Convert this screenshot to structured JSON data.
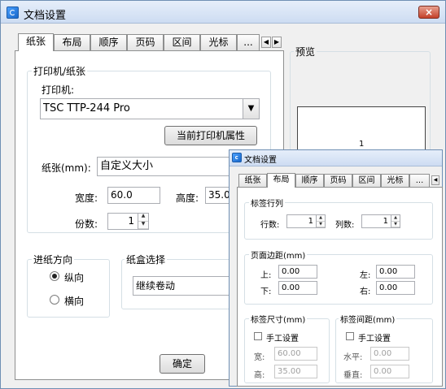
{
  "main_dialog": {
    "title": "文档设置",
    "close_label": "×",
    "tabs": [
      "纸张",
      "布局",
      "顺序",
      "页码",
      "区间",
      "光标",
      "..."
    ],
    "printer_group_title": "打印机/纸张",
    "printer_label": "打印机:",
    "printer_value": "TSC TTP-244 Pro",
    "printer_props_button": "当前打印机属性",
    "paper_label": "纸张(mm):",
    "paper_value": "自定义大小",
    "width_label": "宽度:",
    "width_value": "60.0",
    "height_label": "高度:",
    "height_value": "35.0",
    "copies_label": "份数:",
    "copies_value": "1",
    "feed_group_title": "进纸方向",
    "feed_portrait": "纵向",
    "feed_landscape": "横向",
    "tray_group_title": "纸盒选择",
    "tray_value": "继续卷动",
    "ok_button": "确定",
    "preview_title": "预览",
    "preview_page_number": "1"
  },
  "layout_dialog": {
    "title": "文档设置",
    "tabs": [
      "纸张",
      "布局",
      "顺序",
      "页码",
      "区间",
      "光标",
      "..."
    ],
    "rows_cols_group": "标签行列",
    "rows_label": "行数:",
    "rows_value": "1",
    "cols_label": "列数:",
    "cols_value": "1",
    "margins_group": "页面边距(mm)",
    "top_label": "上:",
    "top_value": "0.00",
    "left_label": "左:",
    "left_value": "0.00",
    "bottom_label": "下:",
    "bottom_value": "0.00",
    "right_label": "右:",
    "right_value": "0.00",
    "size_group": "标签尺寸(mm)",
    "size_manual": "手工设置",
    "size_width_label": "宽:",
    "size_width_value": "60.00",
    "size_height_label": "高:",
    "size_height_value": "35.00",
    "gap_group": "标签间距(mm)",
    "gap_manual": "手工设置",
    "gap_h_label": "水平:",
    "gap_h_value": "0.00",
    "gap_v_label": "垂直:",
    "gap_v_value": "0.00"
  }
}
